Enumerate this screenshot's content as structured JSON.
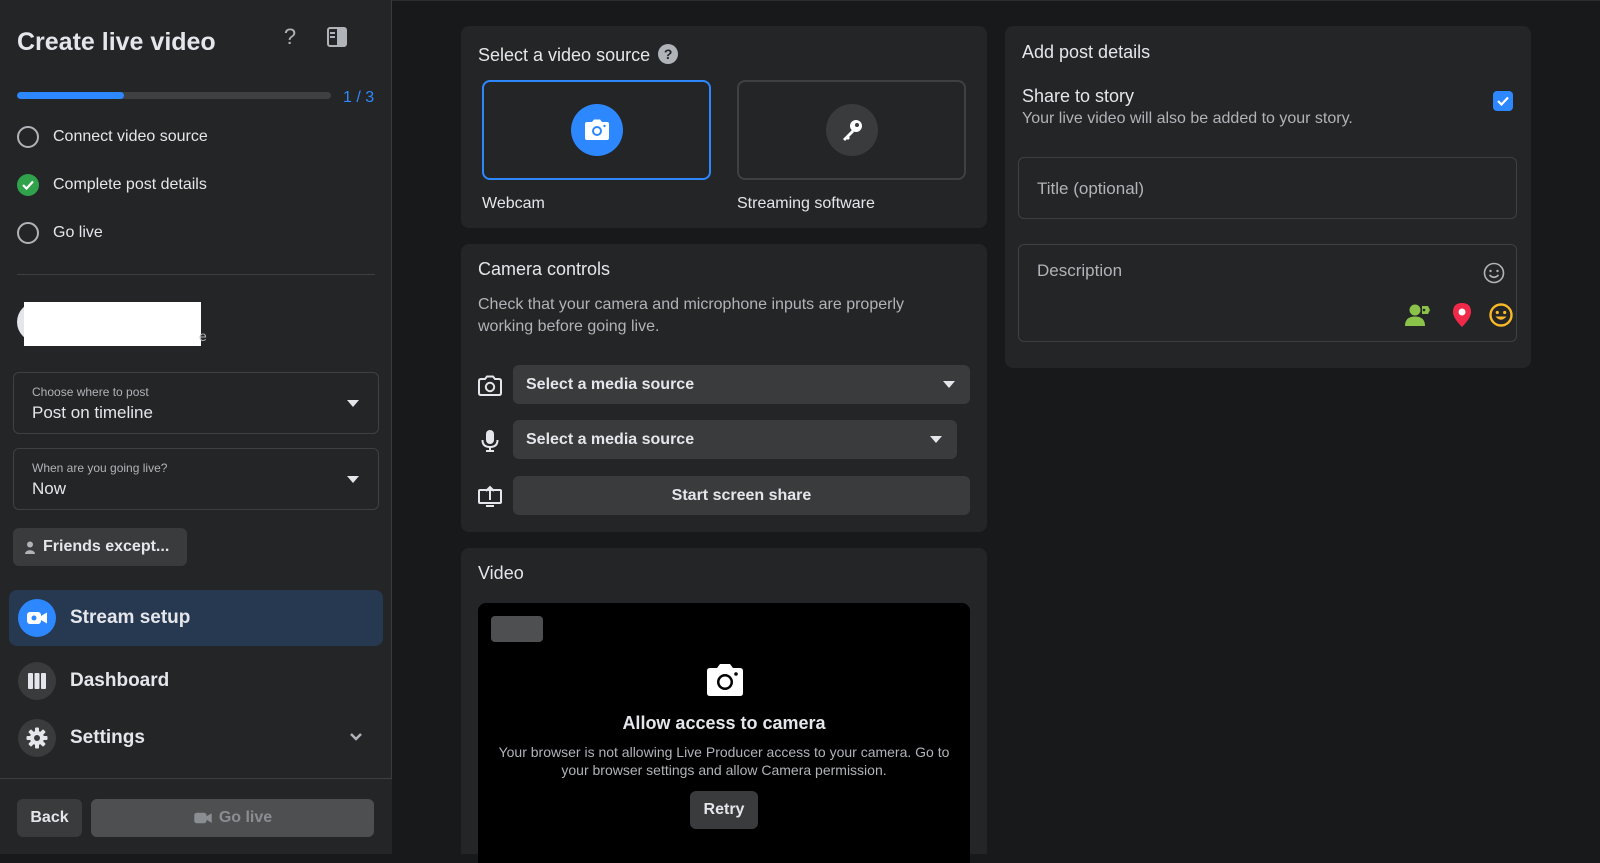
{
  "sidebar": {
    "title": "Create live video",
    "progress": {
      "label": "1 / 3",
      "fraction": 0.34
    },
    "steps": [
      {
        "label": "Connect video source",
        "done": false
      },
      {
        "label": "Complete post details",
        "done": true
      },
      {
        "label": "Go live",
        "done": false
      }
    ],
    "profile": {
      "suffix": "e"
    },
    "post_where": {
      "label": "Choose where to post",
      "value": "Post on timeline"
    },
    "when_live": {
      "label": "When are you going live?",
      "value": "Now"
    },
    "audience": {
      "label": "Friends except..."
    },
    "nav": [
      {
        "label": "Stream setup",
        "icon": "video-camera-icon",
        "active": true
      },
      {
        "label": "Dashboard",
        "icon": "dashboard-icon",
        "active": false
      },
      {
        "label": "Settings",
        "icon": "gear-icon",
        "active": false
      }
    ],
    "footer": {
      "back_label": "Back",
      "golive_label": "Go live"
    }
  },
  "video_source": {
    "title": "Select a video source",
    "help_glyph": "?",
    "options": [
      {
        "label": "Webcam",
        "icon": "camera-icon",
        "selected": true
      },
      {
        "label": "Streaming software",
        "icon": "key-icon",
        "selected": false
      }
    ]
  },
  "camera_controls": {
    "title": "Camera controls",
    "description": "Check that your camera and microphone inputs are properly working before going live.",
    "camera_select": "Select a media source",
    "mic_select": "Select a media source",
    "screen_share": "Start screen share"
  },
  "video": {
    "title": "Video",
    "heading": "Allow access to camera",
    "message": "Your browser is not allowing Live Producer access to your camera. Go to your browser settings and allow Camera permission.",
    "retry_label": "Retry"
  },
  "post_details": {
    "title": "Add post details",
    "share_title": "Share to story",
    "share_desc": "Your live video will also be added to your story.",
    "share_checked": true,
    "title_placeholder": "Title (optional)",
    "description_placeholder": "Description"
  },
  "colors": {
    "accent": "#2d88ff",
    "success": "#31a24c",
    "location": "#f02849",
    "feeling": "#f7b928",
    "tag": "#8bc34a"
  }
}
